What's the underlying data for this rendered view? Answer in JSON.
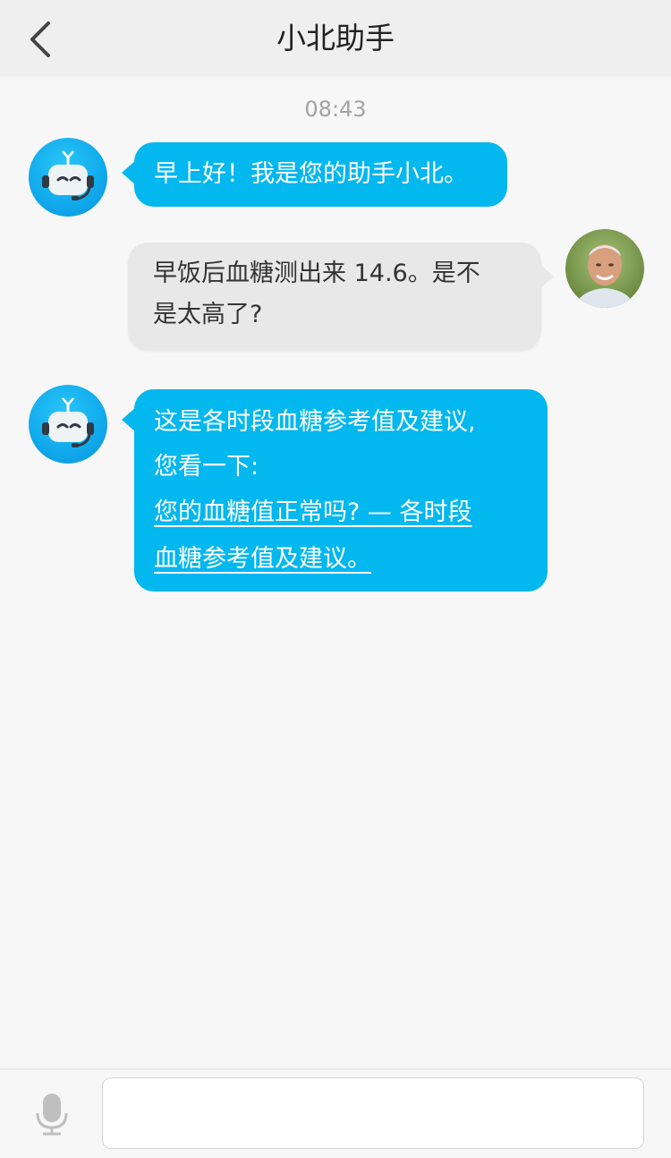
{
  "header": {
    "title": "小北助手",
    "back_icon": "chevron-left-icon"
  },
  "chat": {
    "timestamp": "08:43",
    "messages": [
      {
        "sender": "bot",
        "lines": [
          "早上好！我是您的助手小北。"
        ]
      },
      {
        "sender": "user",
        "lines": [
          "早饭后血糖测出来 14.6。是不",
          "是太高了?"
        ]
      },
      {
        "sender": "bot",
        "lines": [
          "这是各时段血糖参考值及建议,",
          "您看一下:"
        ],
        "link_lines": [
          "您的血糖值正常吗? — 各时段",
          "血糖参考值及建议。"
        ]
      }
    ]
  },
  "input": {
    "value": "",
    "placeholder": "",
    "mic_icon": "microphone-icon"
  },
  "colors": {
    "bot_bubble": "#03b7ef",
    "user_bubble": "#e8e8e8",
    "header_bg": "#efefef"
  }
}
